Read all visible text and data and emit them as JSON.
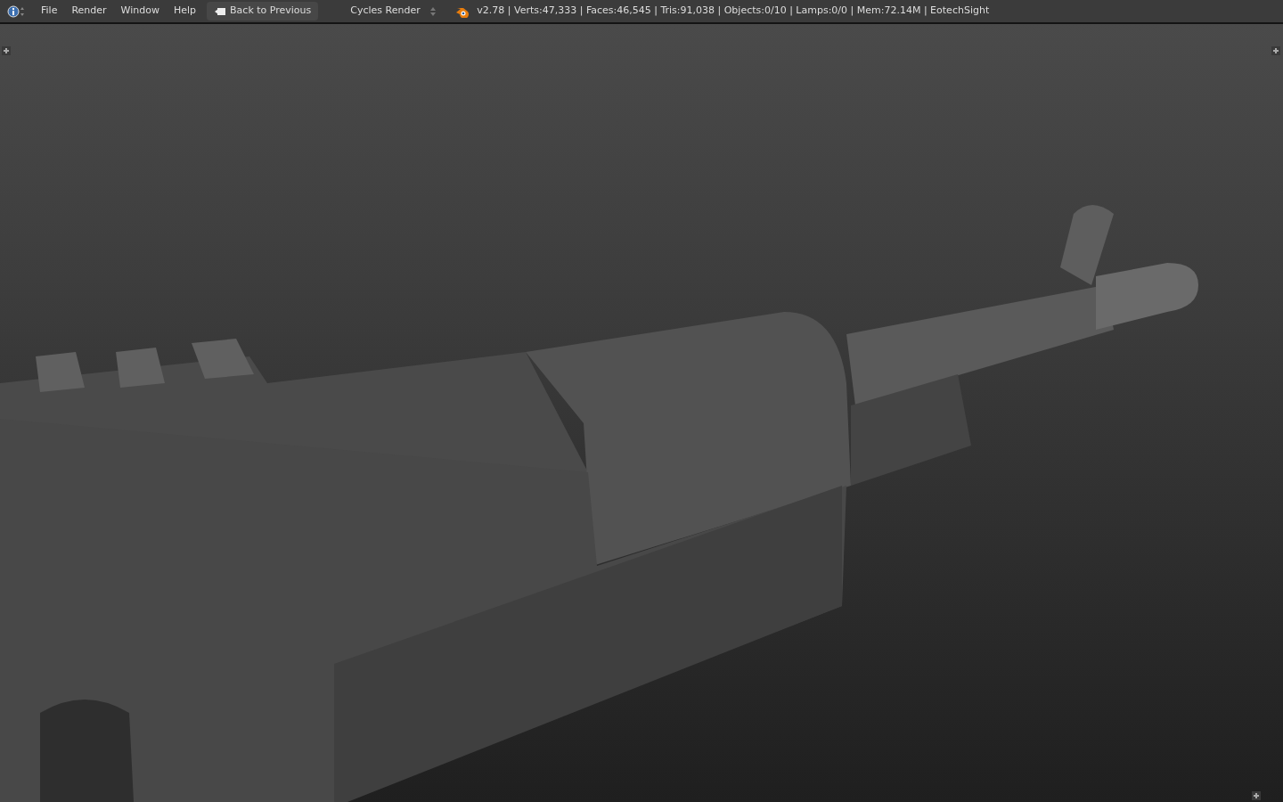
{
  "header": {
    "menus": [
      "File",
      "Render",
      "Window",
      "Help"
    ],
    "back_button": {
      "label": "Back to Previous"
    },
    "render_engine": {
      "value": "Cycles Render"
    },
    "stats": "v2.78 | Verts:47,333 | Faces:46,545 | Tris:91,038 | Objects:0/10 | Lamps:0/0 | Mem:72.14M | EotechSight"
  }
}
